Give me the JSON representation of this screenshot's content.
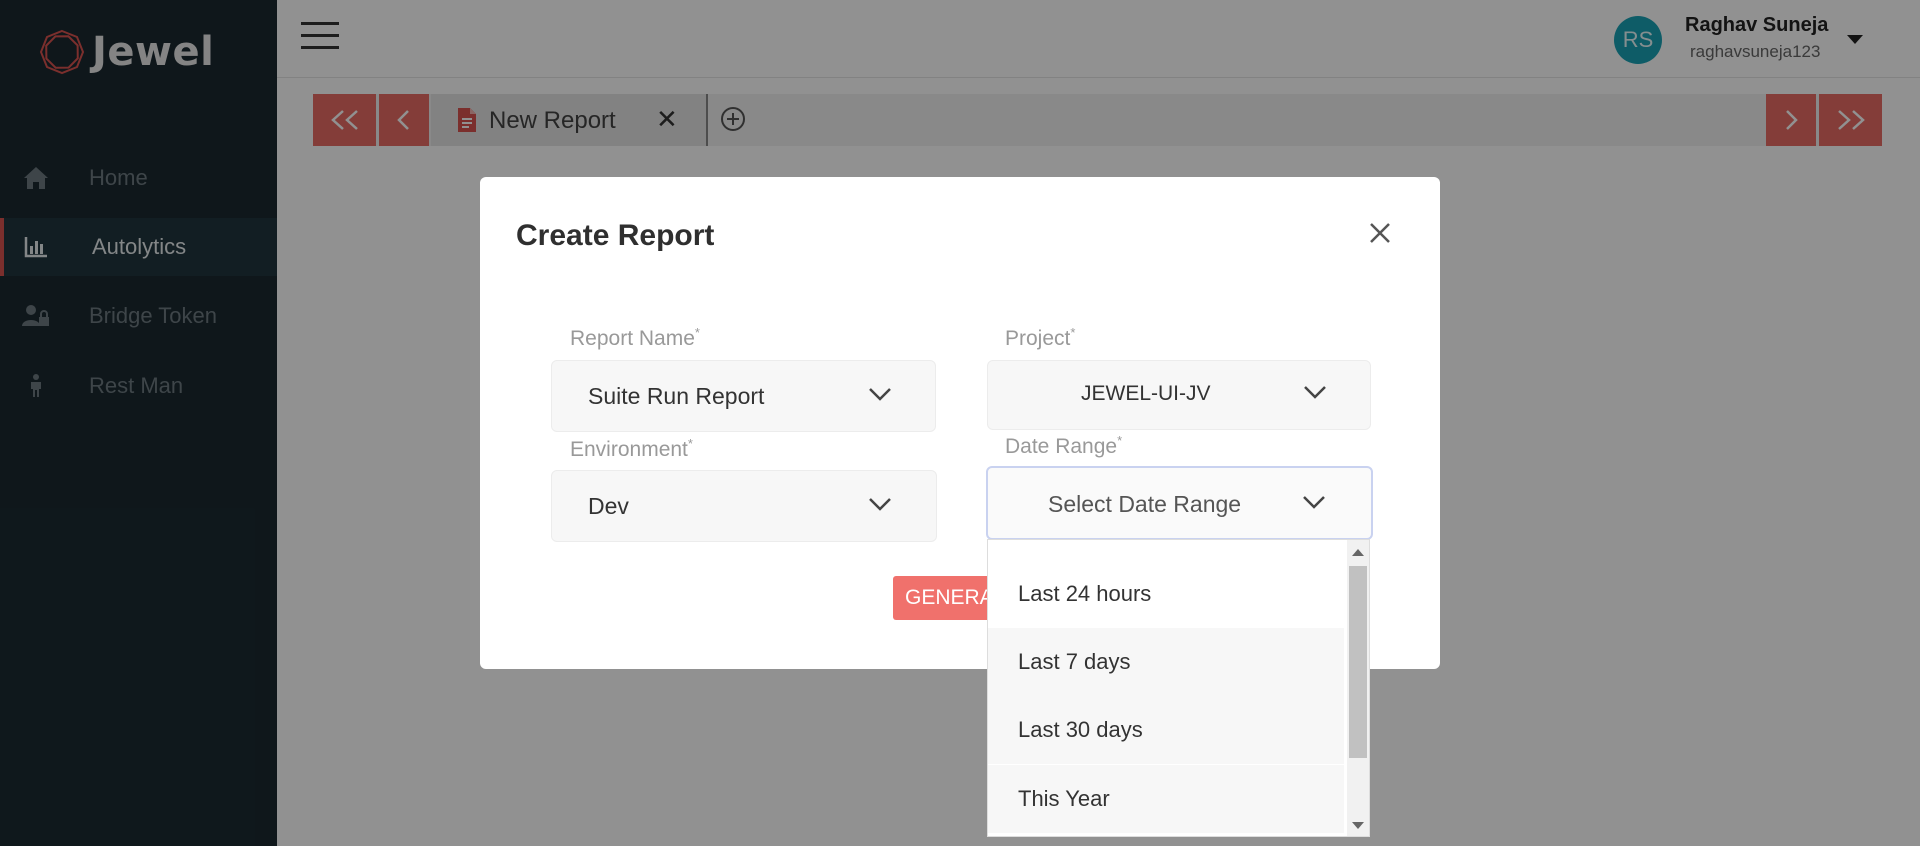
{
  "app": {
    "name": "Jewel"
  },
  "colors": {
    "sidebar_bg": "#1b2a31",
    "accent": "#e86b64",
    "avatar": "#1aa3b5",
    "generate": "#f0716c"
  },
  "sidebar": {
    "items": [
      {
        "label": "Home",
        "icon": "home-icon",
        "active": false
      },
      {
        "label": "Autolytics",
        "icon": "bar-chart-icon",
        "active": true
      },
      {
        "label": "Bridge Token",
        "icon": "user-lock-icon",
        "active": false
      },
      {
        "label": "Rest Man",
        "icon": "person-icon",
        "active": false
      }
    ]
  },
  "header": {
    "user": {
      "initials": "RS",
      "name": "Raghav Suneja",
      "username": "raghavsuneja123"
    }
  },
  "tabs": {
    "first_label": "<<",
    "prev_label": "<",
    "next_label": ">",
    "last_label": ">>",
    "items": [
      {
        "label": "New Report",
        "close": "✕"
      }
    ]
  },
  "modal": {
    "title": "Create Report",
    "fields": {
      "report_name": {
        "label": "Report Name",
        "required": "*",
        "value": "Suite Run Report"
      },
      "project": {
        "label": "Project",
        "required": "*",
        "value": "JEWEL-UI-JV"
      },
      "environment": {
        "label": "Environment",
        "required": "*",
        "value": "Dev"
      },
      "date_range": {
        "label": "Date Range",
        "required": "*",
        "placeholder": "Select Date Range"
      }
    },
    "generate_label": "GENERATE",
    "date_range_options": [
      "Last 24 hours",
      "Last 7 days",
      "Last 30 days",
      "This Year"
    ]
  }
}
